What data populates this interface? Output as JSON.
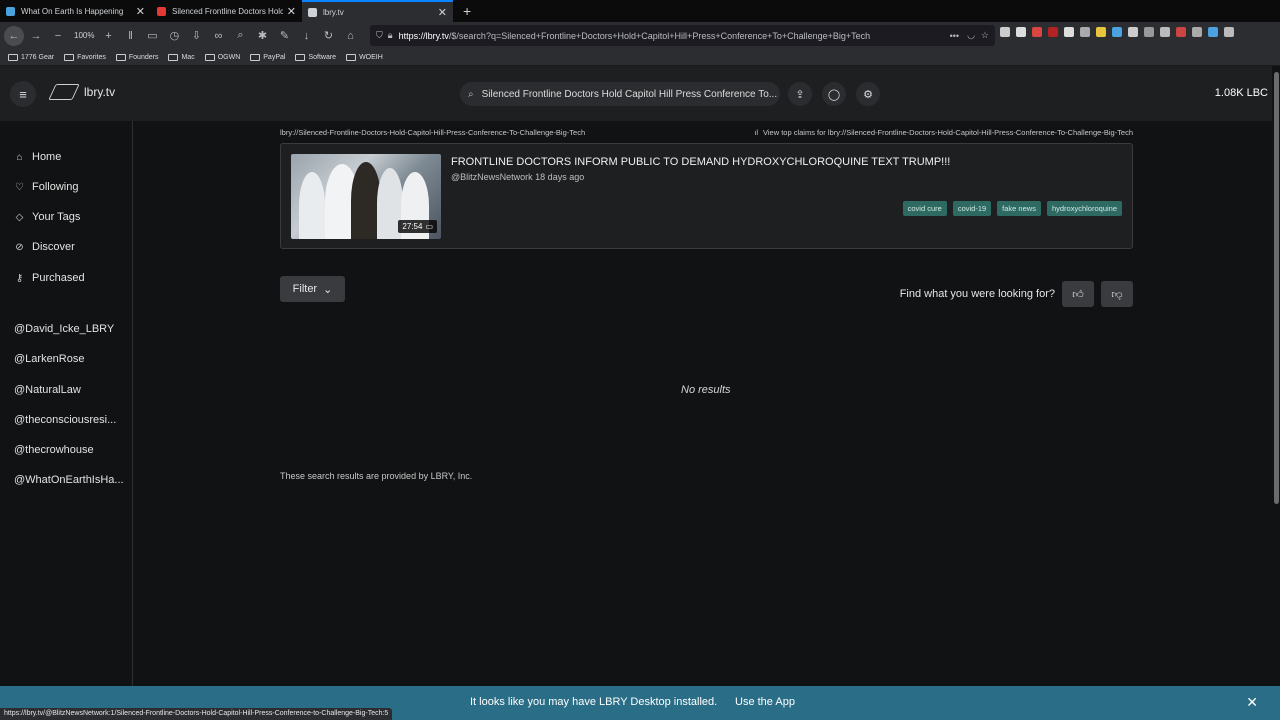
{
  "browser": {
    "tabs": [
      {
        "title": "What On Earth Is Happening",
        "favicon_color": "#4aa3df",
        "active": false
      },
      {
        "title": "Silenced Frontline Doctors Holc",
        "favicon_color": "#e53935",
        "active": false
      },
      {
        "title": "lbry.tv",
        "favicon_color": "#cfd2d6",
        "active": true
      }
    ],
    "zoom": "100%",
    "url_host": "https://lbry.tv",
    "url_path": "/$/search?q=Silenced+Frontline+Doctors+Hold+Capitol+Hill+Press+Conference+To+Challenge+Big+Tech",
    "bookmarks": [
      "1776 Gear",
      "Favorites",
      "Founders",
      "Mac",
      "OGWN",
      "PayPal",
      "Software",
      "WOEIH"
    ],
    "status_url": "https://lbry.tv/@BlitzNewsNetwork:1/Silenced-Frontline-Doctors-Hold-Capitol-Hill-Press-Conference-to-Challenge-Big-Tech:5"
  },
  "header": {
    "site_name": "lbry.tv",
    "search_value": "Silenced Frontline Doctors Hold Capitol Hill Press Conference To...",
    "balance": "1.08K LBC"
  },
  "sidebar": {
    "nav": [
      {
        "label": "Home",
        "icon": "home-icon"
      },
      {
        "label": "Following",
        "icon": "heart-icon"
      },
      {
        "label": "Your Tags",
        "icon": "tag-icon"
      },
      {
        "label": "Discover",
        "icon": "compass-icon"
      },
      {
        "label": "Purchased",
        "icon": "key-icon"
      }
    ],
    "channels": [
      "@David_Icke_LBRY",
      "@LarkenRose",
      "@NaturalLaw",
      "@theconsciousresi...",
      "@thecrowhouse",
      "@WhatOnEarthIsHa..."
    ]
  },
  "main": {
    "claim_uri": "lbry://Silenced-Frontline-Doctors-Hold-Capitol-Hill-Press-Conference-To-Challenge-Big-Tech",
    "top_claims": "View top claims for lbry://Silenced-Frontline-Doctors-Hold-Capitol-Hill-Press-Conference-To-Challenge-Big-Tech",
    "result": {
      "title": "FRONTLINE DOCTORS INFORM PUBLIC TO DEMAND HYDROXYCHLOROQUINE TEXT TRUMP!!!",
      "channel": "@BlitzNewsNetwork",
      "age": "18 days ago",
      "duration": "27:54",
      "tags": [
        "covid cure",
        "covid-19",
        "fake news",
        "hydroxychloroquine"
      ]
    },
    "filter_label": "Filter",
    "feedback_question": "Find what you were looking for?",
    "no_results": "No results",
    "provided_by": "These search results are provided by LBRY, Inc."
  },
  "banner": {
    "text": "It looks like you may have LBRY Desktop installed.",
    "link": "Use the App"
  }
}
